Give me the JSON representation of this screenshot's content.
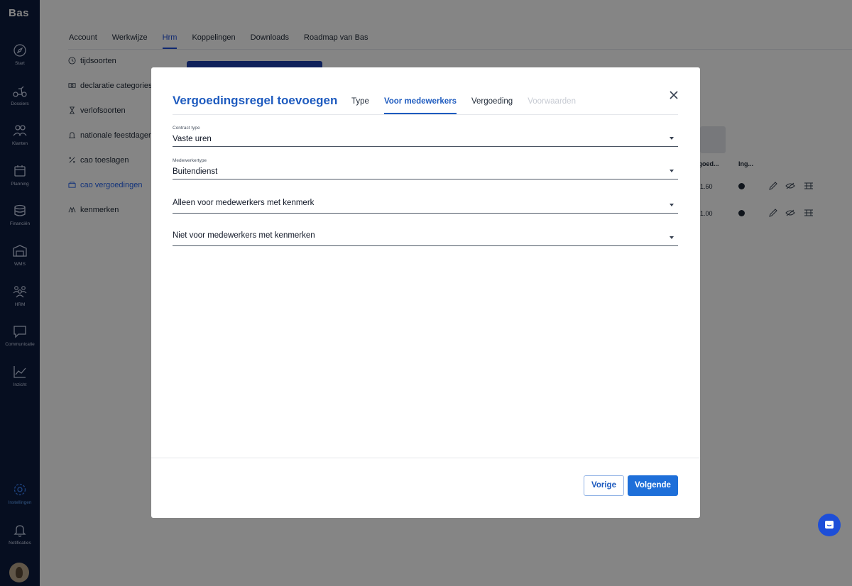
{
  "sidebar": {
    "logo": "Bas",
    "items": [
      {
        "label": "Start",
        "icon": "compass-icon"
      },
      {
        "label": "Dossiers",
        "icon": "scooter-icon"
      },
      {
        "label": "Klanten",
        "icon": "people-icon"
      },
      {
        "label": "Planning",
        "icon": "calendar-icon"
      },
      {
        "label": "Financiën",
        "icon": "coins-icon"
      },
      {
        "label": "WMS",
        "icon": "warehouse-icon"
      },
      {
        "label": "HRM",
        "icon": "team-icon"
      },
      {
        "label": "Communicatie",
        "icon": "chat-icon"
      },
      {
        "label": "Inzicht",
        "icon": "chart-icon"
      }
    ],
    "bottom_items": [
      {
        "label": "Instellingen",
        "icon": "gear-icon"
      },
      {
        "label": "Notificaties",
        "icon": "bell-icon"
      }
    ]
  },
  "top_tabs": [
    "Account",
    "Werkwijze",
    "Hrm",
    "Koppelingen",
    "Downloads",
    "Roadmap van Bas"
  ],
  "active_top_tab": "Hrm",
  "settings_menu": [
    {
      "label": "tijdsoorten",
      "icon": "clock-icon"
    },
    {
      "label": "declaratie categories",
      "icon": "money-icon"
    },
    {
      "label": "verlofsoorten",
      "icon": "hourglass-icon"
    },
    {
      "label": "nationale feestdagen",
      "icon": "bell-icon"
    },
    {
      "label": "cao toeslagen",
      "icon": "percent-icon"
    },
    {
      "label": "cao vergoedingen",
      "icon": "cash-icon"
    },
    {
      "label": "kenmerken",
      "icon": "tags-icon"
    }
  ],
  "background_table": {
    "headers": [
      "...goed...",
      "Ing..."
    ],
    "rows": [
      {
        "value": "1.60"
      },
      {
        "value": "1.00"
      }
    ]
  },
  "modal": {
    "title": "Vergoedingsregel toevoegen",
    "tabs": [
      {
        "label": "Type",
        "state": "normal"
      },
      {
        "label": "Voor medewerkers",
        "state": "active"
      },
      {
        "label": "Vergoeding",
        "state": "normal"
      },
      {
        "label": "Voorwaarden",
        "state": "disabled"
      }
    ],
    "fields": {
      "contract_type": {
        "label": "Contract type",
        "value": "Vaste uren"
      },
      "medewerkertype": {
        "label": "Medewerkertype",
        "value": "Buitendienst"
      },
      "alleen_kenmerk": {
        "label": "",
        "value": "Alleen voor medewerkers met kenmerk"
      },
      "niet_kenmerken": {
        "label": "",
        "value": "Niet voor medewerkers met kenmerken"
      }
    },
    "buttons": {
      "previous": "Vorige",
      "next": "Volgende"
    }
  },
  "colors": {
    "sidebar": "#0d1b3e",
    "accent": "#1e5bbf",
    "primary_button": "#1e6fd9"
  }
}
